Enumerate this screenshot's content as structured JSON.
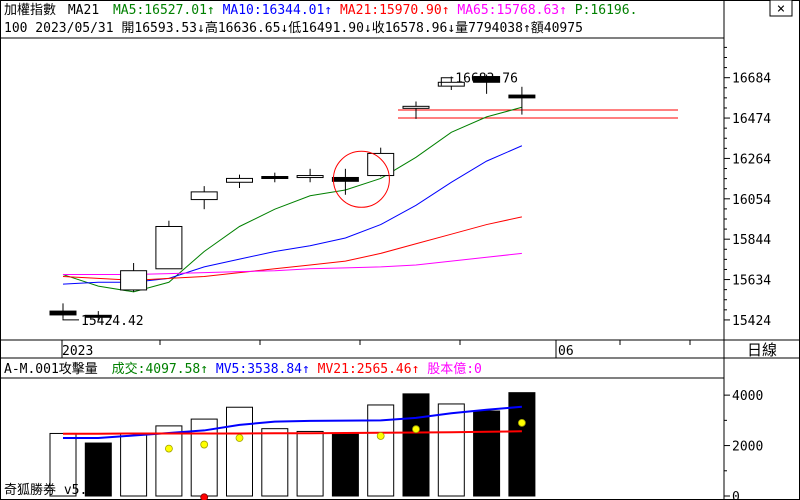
{
  "header": {
    "index_name": "加權指數",
    "ma_label": "MA21",
    "ma5": "MA5:16527.01↑",
    "ma10": "MA10:16344.01↑",
    "ma21": "MA21:15970.90↑",
    "ma65": "MA65:15768.63↑",
    "p": "P:16196.",
    "ohlc_line": "100 2023/05/31 開16593.53↓高16636.65↓低16491.90↓收16578.96↓量7794038↑額40975"
  },
  "volume_header": {
    "title": "A-M.001攻擊量",
    "volume": "成交:4097.58↑",
    "mv5": "MV5:3538.84↑",
    "mv21": "MV21:2565.46↑",
    "capital": "股本億:0"
  },
  "period_button": "日線",
  "close_button": "×",
  "footer": {
    "brand": "奇狐勝券 v5.2"
  },
  "colors": {
    "ma5": "#008000",
    "ma10": "#0000ff",
    "ma21": "#ff0000",
    "ma65": "#ff00ff",
    "volume_up": "#ffffff",
    "volume_down": "#000000",
    "highlight_circle": "#ff0000"
  },
  "chart_data": [
    {
      "type": "candlestick",
      "x_tick_labels": [
        "2023",
        "06"
      ],
      "y_ticks": [
        15424,
        15634,
        15844,
        16054,
        16264,
        16474,
        16684
      ],
      "ylim": [
        15330,
        16880
      ],
      "annotations": [
        "16683.76",
        "15424.42"
      ],
      "horizontal_line": 16474,
      "candles": [
        {
          "open": 15470,
          "high": 15510,
          "low": 15430,
          "close": 15450
        },
        {
          "open": 15448,
          "high": 15470,
          "low": 15420,
          "close": 15440
        },
        {
          "open": 15580,
          "high": 15720,
          "low": 15570,
          "close": 15680
        },
        {
          "open": 15690,
          "high": 15940,
          "low": 15690,
          "close": 15910
        },
        {
          "open": 16050,
          "high": 16120,
          "low": 16000,
          "close": 16090
        },
        {
          "open": 16140,
          "high": 16180,
          "low": 16110,
          "close": 16160
        },
        {
          "open": 16170,
          "high": 16190,
          "low": 16140,
          "close": 16165
        },
        {
          "open": 16170,
          "high": 16210,
          "low": 16140,
          "close": 16175
        },
        {
          "open": 16165,
          "high": 16210,
          "low": 16075,
          "close": 16145
        },
        {
          "open": 16175,
          "high": 16320,
          "low": 16170,
          "close": 16290
        },
        {
          "open": 16530,
          "high": 16560,
          "low": 16470,
          "close": 16535
        },
        {
          "open": 16640,
          "high": 16690,
          "low": 16620,
          "close": 16660
        },
        {
          "open": 16690,
          "high": 16700,
          "low": 16600,
          "close": 16660
        },
        {
          "open": 16593.53,
          "high": 16636.65,
          "low": 16491.9,
          "close": 16578.96
        }
      ],
      "highlight_candle": 8,
      "series": [
        {
          "name": "MA5",
          "values": [
            15660,
            15600,
            15570,
            15620,
            15780,
            15910,
            16000,
            16070,
            16100,
            16160,
            16270,
            16400,
            16480,
            16530
          ]
        },
        {
          "name": "MA10",
          "values": [
            15610,
            15620,
            15620,
            15640,
            15700,
            15740,
            15780,
            15810,
            15850,
            15920,
            16020,
            16140,
            16250,
            16330
          ]
        },
        {
          "name": "MA21",
          "values": [
            15650,
            15640,
            15630,
            15640,
            15650,
            15670,
            15690,
            15710,
            15730,
            15770,
            15820,
            15870,
            15920,
            15960
          ]
        },
        {
          "name": "MA65",
          "values": [
            15660,
            15660,
            15660,
            15665,
            15670,
            15675,
            15680,
            15690,
            15695,
            15700,
            15710,
            15730,
            15750,
            15770
          ]
        }
      ]
    },
    {
      "type": "bar",
      "title": "A-M.001攻擊量",
      "y_ticks": [
        0,
        2000,
        4000
      ],
      "ylim": [
        0,
        4600
      ],
      "volumes": [
        2480,
        2100,
        2470,
        2780,
        3050,
        3520,
        2670,
        2560,
        2480,
        3610,
        4050,
        3650,
        3370,
        4097.58
      ],
      "down": [
        false,
        true,
        false,
        false,
        false,
        false,
        false,
        false,
        true,
        false,
        true,
        false,
        true,
        true
      ],
      "marker_values": [
        null,
        null,
        null,
        1880,
        2040,
        2300,
        null,
        null,
        null,
        2380,
        2650,
        null,
        null,
        2900
      ],
      "red_dot_index": 4,
      "red_dot_value": -50,
      "series": [
        {
          "name": "MV5",
          "values": [
            2300,
            2300,
            2400,
            2500,
            2600,
            2820,
            2950,
            2980,
            2990,
            3000,
            3100,
            3280,
            3420,
            3538.84
          ]
        },
        {
          "name": "MV21",
          "values": [
            2470,
            2470,
            2480,
            2480,
            2480,
            2480,
            2490,
            2490,
            2500,
            2510,
            2520,
            2530,
            2550,
            2565.46
          ]
        }
      ]
    }
  ]
}
